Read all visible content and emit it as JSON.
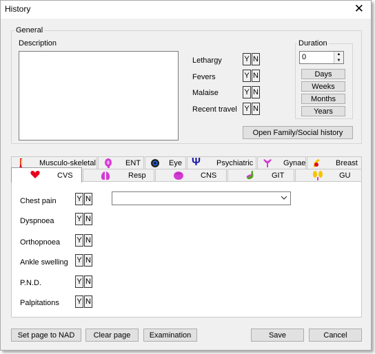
{
  "window": {
    "title": "History",
    "close_glyph": "✕"
  },
  "general": {
    "label": "General",
    "description_label": "Description",
    "description_value": "",
    "symptoms": [
      {
        "label": "Lethargy",
        "yes": "Y",
        "no": "N"
      },
      {
        "label": "Fevers",
        "yes": "Y",
        "no": "N"
      },
      {
        "label": "Malaise",
        "yes": "Y",
        "no": "N"
      },
      {
        "label": "Recent travel",
        "yes": "Y",
        "no": "N"
      }
    ],
    "duration": {
      "label": "Duration",
      "value": "0",
      "units": [
        "Days",
        "Weeks",
        "Months",
        "Years"
      ]
    },
    "family_button": "Open Family/Social history"
  },
  "tabs": {
    "row1": [
      {
        "label": "Musculo-skeletal",
        "icon": "bone-icon"
      },
      {
        "label": "ENT",
        "icon": "ear-icon"
      },
      {
        "label": "Eye",
        "icon": "eye-icon"
      },
      {
        "label": "Psychiatric",
        "icon": "psi-icon"
      },
      {
        "label": "Gynae",
        "icon": "uterus-icon"
      },
      {
        "label": "Breast",
        "icon": "breast-icon"
      }
    ],
    "row2": [
      {
        "label": "CVS",
        "icon": "heart-icon",
        "active": true
      },
      {
        "label": "Resp",
        "icon": "lungs-icon"
      },
      {
        "label": "CNS",
        "icon": "brain-icon"
      },
      {
        "label": "GIT",
        "icon": "stomach-icon"
      },
      {
        "label": "GU",
        "icon": "kidney-icon"
      }
    ]
  },
  "cvs": {
    "items": [
      {
        "label": "Chest pain",
        "yes": "Y",
        "no": "N"
      },
      {
        "label": "Dyspnoea",
        "yes": "Y",
        "no": "N"
      },
      {
        "label": "Orthopnoea",
        "yes": "Y",
        "no": "N"
      },
      {
        "label": "Ankle swelling",
        "yes": "Y",
        "no": "N"
      },
      {
        "label": "P.N.D.",
        "yes": "Y",
        "no": "N"
      },
      {
        "label": "Palpitations",
        "yes": "Y",
        "no": "N"
      }
    ],
    "combo_value": ""
  },
  "footer": {
    "set_nad": "Set page to NAD",
    "clear": "Clear page",
    "examination": "Examination",
    "save": "Save",
    "cancel": "Cancel"
  },
  "colors": {
    "window_bg": "#f0f0f0",
    "accent": "#0078d7",
    "heart": "#e8001c",
    "magenta": "#d43bd4",
    "psi": "#1a1aa8"
  }
}
